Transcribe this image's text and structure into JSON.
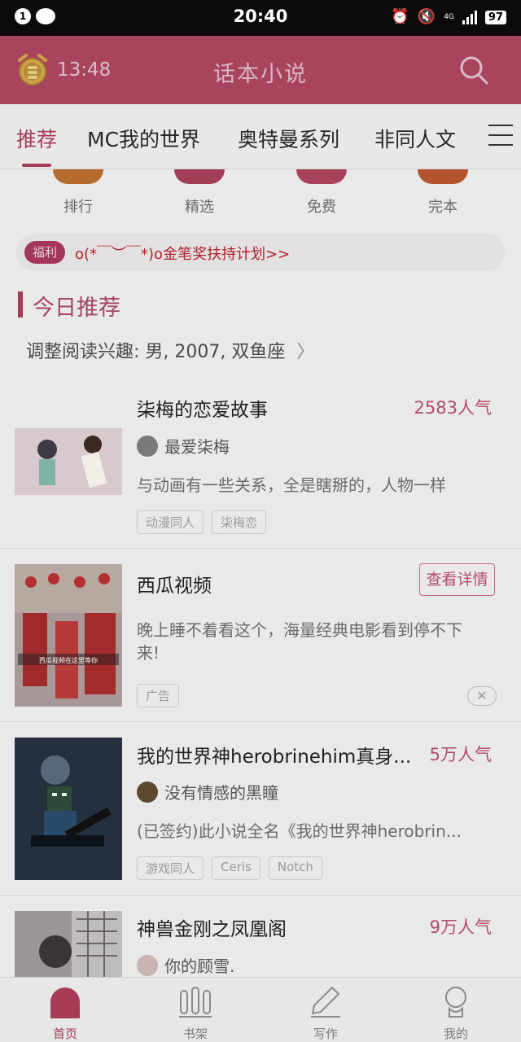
{
  "status_bar": {
    "notification_count": "1",
    "time": "20:40",
    "network": "4G",
    "battery": "97"
  },
  "header": {
    "clock_time": "13:48",
    "title": "话本小说"
  },
  "tabs": [
    {
      "label": "推荐"
    },
    {
      "label": "MC我的世界"
    },
    {
      "label": "奥特曼系列"
    },
    {
      "label": "非同人文"
    }
  ],
  "categories": [
    {
      "label": "排行",
      "color": "#b56a2e"
    },
    {
      "label": "精选",
      "color": "#a23d58"
    },
    {
      "label": "免费",
      "color": "#a8415a"
    },
    {
      "label": "完本",
      "color": "#b5532e"
    }
  ],
  "banner": {
    "tag": "福利",
    "text": "o(*￣︶￣*)o金笔奖扶持计划>>"
  },
  "section": {
    "title": "今日推荐",
    "preference": "调整阅读兴趣: 男, 2007, 双鱼座"
  },
  "feed": [
    {
      "title": "柒梅的恋爱故事",
      "popularity": "2583人气",
      "author": "最爱柒梅",
      "description": "与动画有一些关系，全是瞎掰的，人物一样",
      "tags": [
        "动漫同人",
        "柒梅恋"
      ]
    },
    {
      "title": "西瓜视频",
      "button": "查看详情",
      "description_line1": "晚上睡不着看这个，海量经典电影看到停不下",
      "description_line2": "来!",
      "tag": "广告",
      "cover_caption": "西瓜视频在这里等你"
    },
    {
      "title": "我的世界神herobrinehim真身...",
      "popularity": "5万人气",
      "author": "没有情感的黑瞳",
      "description": "(已签约)此小说全名《我的世界神herobrin...",
      "tags": [
        "游戏同人",
        "Ceris",
        "Notch"
      ]
    },
    {
      "title": "神兽金刚之凤凰阁",
      "popularity": "9万人气",
      "author": "你的顾雪."
    }
  ],
  "bottom_nav": [
    {
      "label": "首页"
    },
    {
      "label": "书架"
    },
    {
      "label": "写作"
    },
    {
      "label": "我的"
    }
  ],
  "colors": {
    "accent": "#a63c57",
    "header_bg": "#a9445f"
  }
}
